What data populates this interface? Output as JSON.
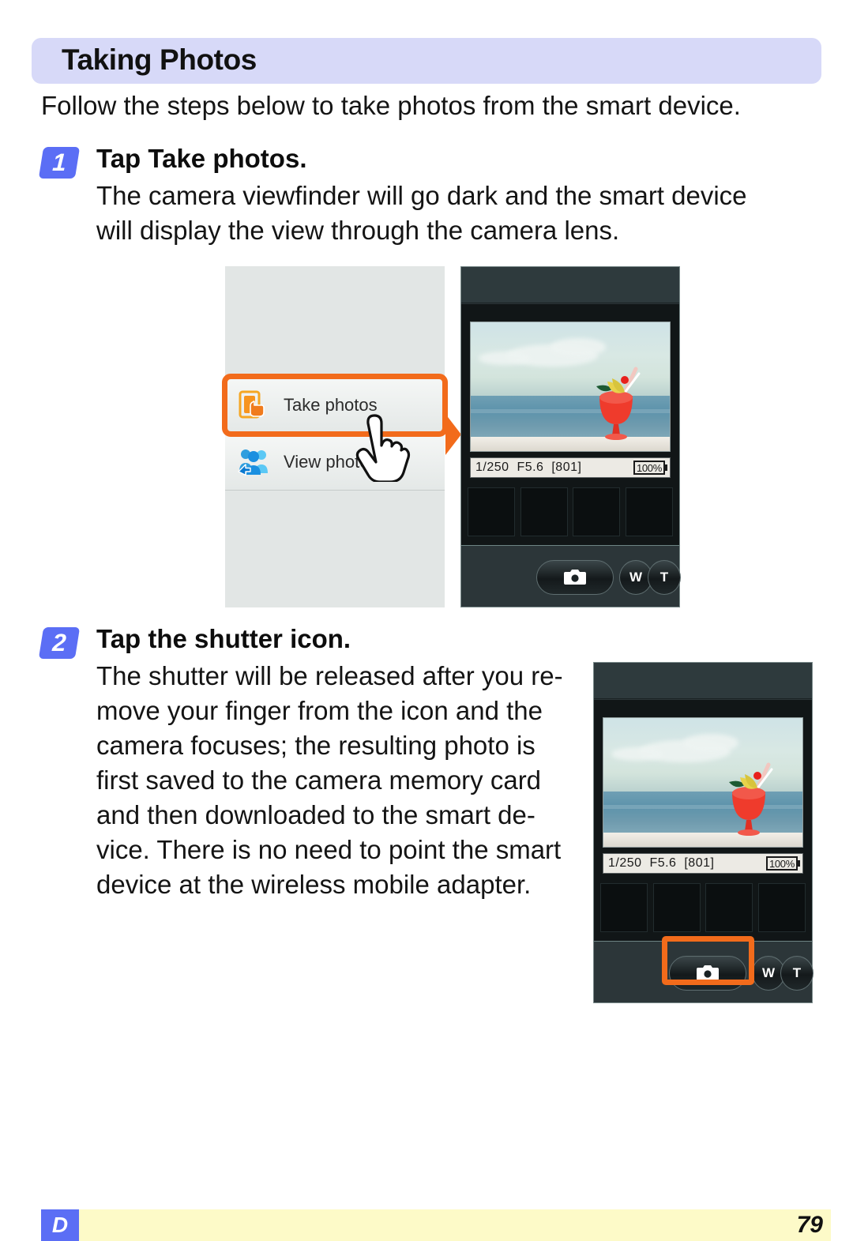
{
  "header": {
    "title": "Taking Photos"
  },
  "intro": "Follow the steps below to take photos from the smart device.",
  "steps": [
    {
      "number": "1",
      "heading_prefix": "Tap ",
      "heading_target": "Take photos",
      "heading_suffix": ".",
      "body_lines": [
        "The camera viewfinder will go dark and the smart device",
        "will display the view through the camera lens."
      ]
    },
    {
      "number": "2",
      "heading_prefix": "Tap the shutter icon.",
      "heading_target": "",
      "heading_suffix": "",
      "body_lines": [
        "The shutter will be released after you re-",
        "move your finger from the icon and the",
        "camera focuses; the resulting photo is",
        "first saved to the camera memory card",
        "and then downloaded to the smart de-",
        "vice. There is no need to point the smart",
        "device at the wireless mobile adapter."
      ]
    }
  ],
  "menu_screenshot": {
    "items": [
      {
        "label": "Take photos",
        "icon": "tap-device-icon",
        "highlighted": "true"
      },
      {
        "label": "View photos",
        "icon": "people-share-icon",
        "highlighted": "false"
      }
    ]
  },
  "camera_screenshot": {
    "shutter_speed": "1/250",
    "aperture": "F5.6",
    "frames_remaining": "[801]",
    "battery_level": "100%",
    "shutter_button_label": "shutter",
    "zoom_wide_label": "W",
    "zoom_tele_label": "T",
    "thumbnail_count": 4
  },
  "footer": {
    "note_badge": "D",
    "page_number": "79"
  },
  "colors": {
    "header_band": "#d7d9f8",
    "step_badge": "#5b6ef5",
    "highlight_orange": "#f26b1b",
    "footer_band": "#fdfac8"
  }
}
